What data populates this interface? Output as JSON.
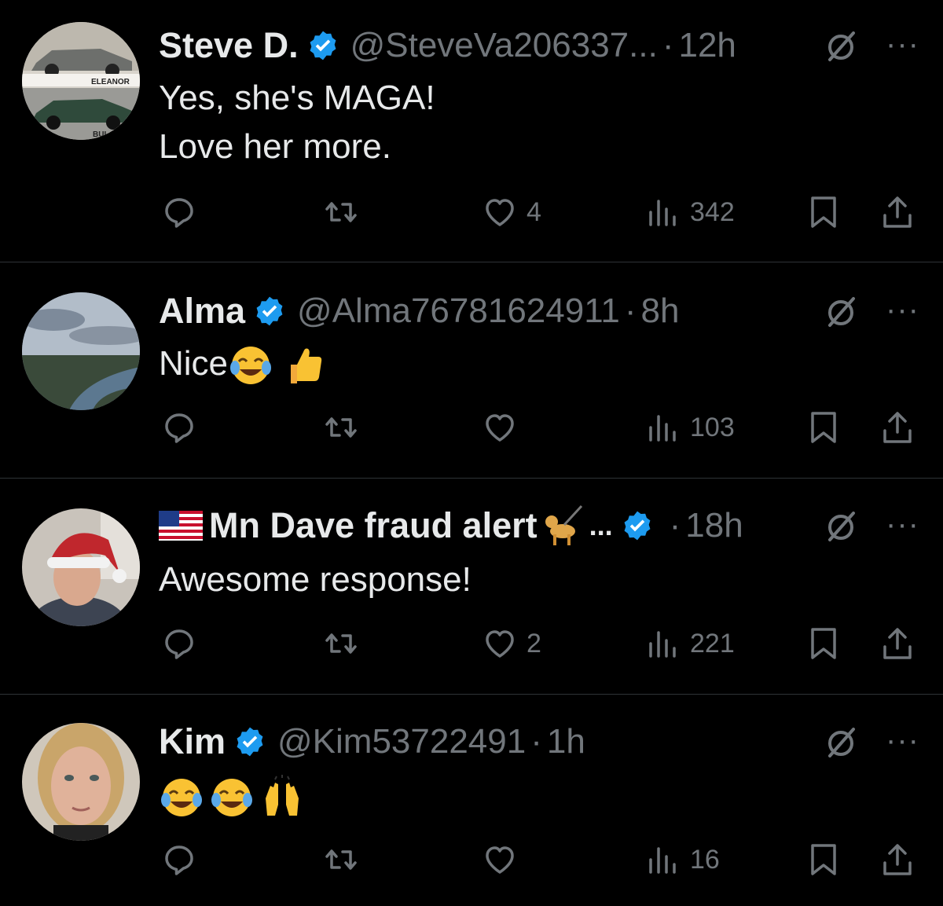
{
  "colors": {
    "background": "#000000",
    "text": "#e7e9ea",
    "muted": "#71767b",
    "verified": "#1d9bf0",
    "divider": "#2f3336"
  },
  "posts": [
    {
      "name": "Steve D.",
      "handle": "@SteveVa206337...",
      "separator": "·",
      "time": "12h",
      "more": "···",
      "text_lines": [
        "Yes, she's  MAGA!",
        "Love her more."
      ],
      "avatar_labels": [
        "ELEANOR",
        "BUL"
      ],
      "stats": {
        "replies": "",
        "reposts": "",
        "likes": "4",
        "views": "342"
      }
    },
    {
      "name": "Alma",
      "handle": "@Alma76781624911",
      "separator": "·",
      "time": "8h",
      "more": "···",
      "text_lines": [
        "Nice"
      ],
      "emojis": [
        "face-with-tears-of-joy",
        "thumbs-up"
      ],
      "stats": {
        "replies": "",
        "reposts": "",
        "likes": "",
        "views": "103"
      }
    },
    {
      "name": "Mn Dave fraud alert",
      "name_suffix": "...",
      "handle": "",
      "separator": "·",
      "time": "18h",
      "more": "···",
      "text_lines": [
        "Awesome response!"
      ],
      "name_emojis": [
        "us-flag",
        "guide-dog"
      ],
      "stats": {
        "replies": "",
        "reposts": "",
        "likes": "2",
        "views": "221"
      }
    },
    {
      "name": "Kim",
      "handle": "@Kim53722491",
      "separator": "·",
      "time": "1h",
      "more": "···",
      "text_lines": [
        ""
      ],
      "emojis": [
        "face-with-tears-of-joy",
        "face-with-tears-of-joy",
        "raising-hands"
      ],
      "stats": {
        "replies": "",
        "reposts": "",
        "likes": "",
        "views": "16"
      }
    }
  ]
}
